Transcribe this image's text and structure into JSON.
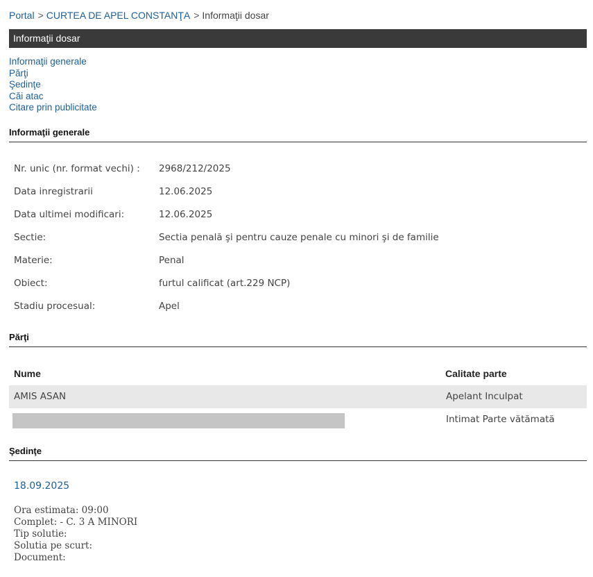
{
  "breadcrumb": {
    "portal": "Portal",
    "sep1": ">",
    "court": "CURTEA DE APEL CONSTANŢA",
    "sep2": ">",
    "current": "Informaţii dosar"
  },
  "title_bar": "Informaţii dosar",
  "anchors": [
    "Informaţii generale",
    "Părţi",
    "Şedinţe",
    "Căi atac",
    "Citare prin publicitate"
  ],
  "general": {
    "heading": "Informaţii generale",
    "rows": [
      {
        "label": "Nr. unic (nr. format vechi) :",
        "value": "2968/212/2025"
      },
      {
        "label": "Data inregistrarii",
        "value": "12.06.2025"
      },
      {
        "label": "Data ultimei modificari:",
        "value": "12.06.2025"
      },
      {
        "label": "Sectie:",
        "value": "Sectia penală şi pentru cauze penale cu minori şi de familie"
      },
      {
        "label": "Materie:",
        "value": "Penal"
      },
      {
        "label": "Obiect:",
        "value": "furtul calificat (art.229 NCP)"
      },
      {
        "label": "Stadiu procesual:",
        "value": "Apel"
      }
    ]
  },
  "parties": {
    "heading": "Părţi",
    "columns": [
      "Nume",
      "Calitate parte"
    ],
    "rows": [
      {
        "name": "AMIS ASAN",
        "role": "Apelant Inculpat",
        "redacted": false
      },
      {
        "name": "",
        "role": "Intimat Parte vătămată",
        "redacted": true
      }
    ]
  },
  "sessions": {
    "heading": "Şedinţe",
    "date": "18.09.2025",
    "details": [
      "Ora estimata: 09:00",
      "Complet: - C. 3 A MINORI",
      "Tip solutie:",
      "Solutia pe scurt:",
      "Document:"
    ]
  }
}
